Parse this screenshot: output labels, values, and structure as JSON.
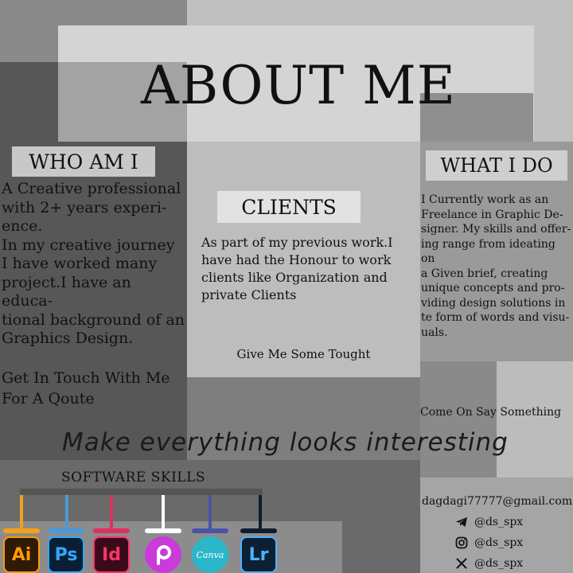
{
  "title": "ABOUT ME",
  "who": {
    "heading": "WHO AM I",
    "lines": [
      "A Creative professional",
      "with 2+ years experi-",
      "ence.",
      "In my creative journey",
      "I have worked many",
      "project.I have an educa-",
      "tional background of an",
      "Graphics Design."
    ],
    "cta_lines": [
      "Get In Touch With Me",
      "For A Qoute"
    ]
  },
  "clients": {
    "heading": "CLIENTS",
    "lines": [
      "As part of my previous work.I",
      "have had the Honour to work",
      "clients like Organization and",
      "private Clients"
    ],
    "footer": "Give  Me Some Tought"
  },
  "what": {
    "heading": "WHAT I DO",
    "lines": [
      "I Currently work as an",
      "Freelance in Graphic De-",
      "signer. My skills and offer-",
      "ing range from ideating on",
      "a Given brief, creating",
      "unique concepts and pro-",
      "viding design solutions in",
      "te form of words and visu-",
      "uals."
    ],
    "footer": "Come On Say Something"
  },
  "tagline": "Make everything looks interesting",
  "skills": {
    "heading": "SOFTWARE SKILLS",
    "tools": [
      {
        "label": "Ai",
        "icon": "illustrator-icon",
        "bg": "#2f1a06",
        "fg": "#ff9a00",
        "line": "#f5a01a"
      },
      {
        "label": "Ps",
        "icon": "photoshop-icon",
        "bg": "#0a1f33",
        "fg": "#31a8ff",
        "line": "#4a9ad8"
      },
      {
        "label": "Id",
        "icon": "indesign-icon",
        "bg": "#3a0a1c",
        "fg": "#ff3366",
        "line": "#e0305e"
      },
      {
        "label": "",
        "icon": "picsart-icon",
        "bg": "#c93cd9",
        "fg": "#ffffff",
        "line": "#ffffff"
      },
      {
        "label": "Canva",
        "icon": "canva-icon",
        "bg": "#2bb6c9",
        "fg": "#ffffff",
        "line": "#4a53a6"
      },
      {
        "label": "Lr",
        "icon": "lightroom-icon",
        "bg": "#0c1f33",
        "fg": "#4fb0ff",
        "line": "#0f1c2c"
      }
    ]
  },
  "contact": {
    "email": "dagdagi77777@gmail.com",
    "telegram": "@ds_spx",
    "instagram": "@ds_spx",
    "x": "@ds_spx"
  }
}
